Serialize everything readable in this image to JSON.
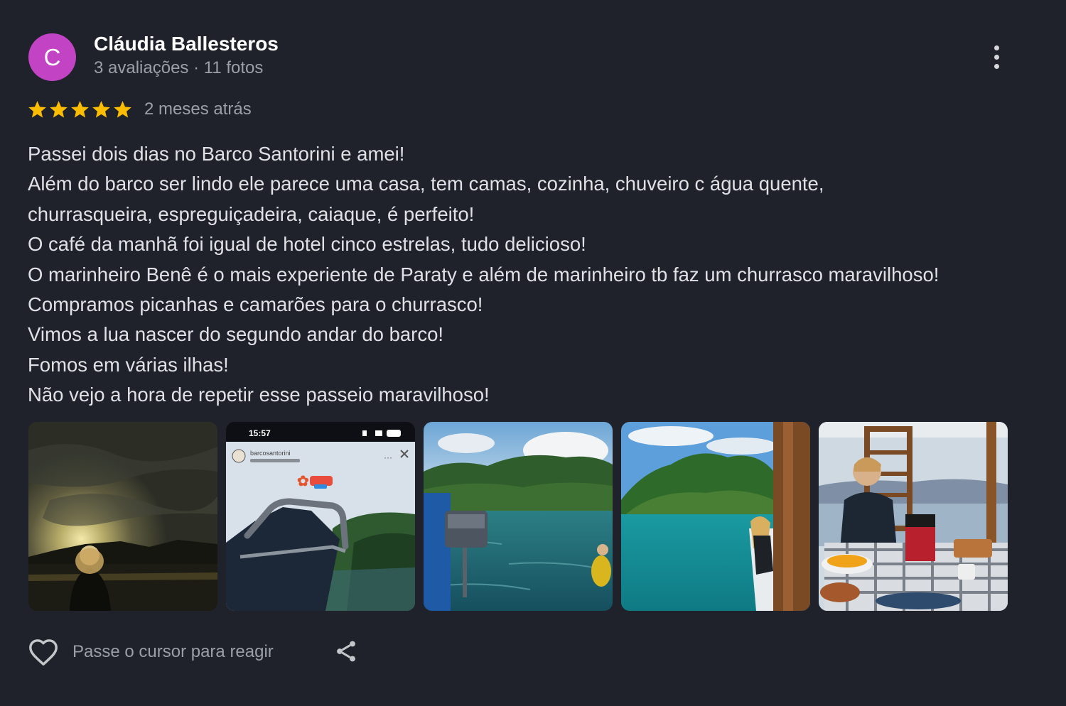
{
  "author": {
    "initial": "C",
    "name": "Cláudia Ballesteros",
    "meta": "3 avaliações · 11 fotos",
    "avatar_color": "#c243c4"
  },
  "rating": {
    "stars": 5,
    "max": 5,
    "star_color": "#fbbc04"
  },
  "date": "2 meses atrás",
  "review_lines": [
    "Passei dois dias no Barco Santorini e amei!",
    "Além do barco ser lindo ele parece uma casa, tem camas, cozinha, chuveiro c água quente,",
    "churrasqueira, espreguiçadeira, caiaque, é perfeito!",
    "O café da manhã foi igual de hotel cinco estrelas, tudo delicioso!",
    "O marinheiro Benê é o mais experiente de Paraty e além de marinheiro tb faz um churrasco maravilhoso!",
    "Compramos picanhas e camarões para o churrasco!",
    "Vimos a lua nascer do segundo andar do barco!",
    "Fomos em várias ilhas!",
    "Não vejo a hora de repetir esse passeio maravilhoso!"
  ],
  "photo_story": {
    "time": "15:57",
    "account": "barcosantorini"
  },
  "icons": {
    "more": "more-vert-icon",
    "star": "star-icon",
    "heart": "heart-outline-icon",
    "share": "share-icon"
  },
  "footer": {
    "react_label": "Passe o cursor para reagir"
  },
  "colors": {
    "background": "#1f222b",
    "text": "#dfe1e5",
    "muted": "#9aa0a6"
  }
}
